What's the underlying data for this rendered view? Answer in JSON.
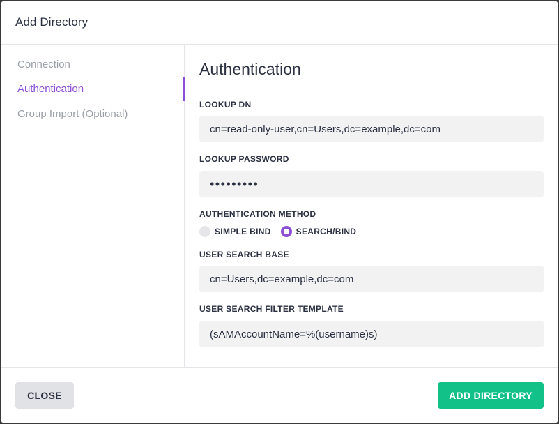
{
  "dialog": {
    "title": "Add Directory"
  },
  "sidebar": {
    "items": [
      {
        "label": "Connection",
        "active": false
      },
      {
        "label": "Authentication",
        "active": true
      },
      {
        "label": "Group Import (Optional)",
        "active": false
      }
    ]
  },
  "main": {
    "title": "Authentication",
    "lookup_dn": {
      "label": "LOOKUP DN",
      "value": "cn=read-only-user,cn=Users,dc=example,dc=com"
    },
    "lookup_password": {
      "label": "LOOKUP PASSWORD",
      "value": "•••••••••"
    },
    "auth_method": {
      "label": "AUTHENTICATION METHOD",
      "options": [
        {
          "label": "SIMPLE BIND",
          "selected": false
        },
        {
          "label": "SEARCH/BIND",
          "selected": true
        }
      ]
    },
    "user_search_base": {
      "label": "USER SEARCH BASE",
      "value": "cn=Users,dc=example,dc=com"
    },
    "user_search_filter": {
      "label": "USER SEARCH FILTER TEMPLATE",
      "value": "(sAMAccountName=%(username)s)"
    }
  },
  "footer": {
    "close_label": "CLOSE",
    "add_label": "ADD DIRECTORY"
  },
  "colors": {
    "accent": "#8e4fd4",
    "primary_button": "#12c187",
    "secondary_button": "#e1e2e5",
    "field_bg": "#f2f2f3"
  }
}
